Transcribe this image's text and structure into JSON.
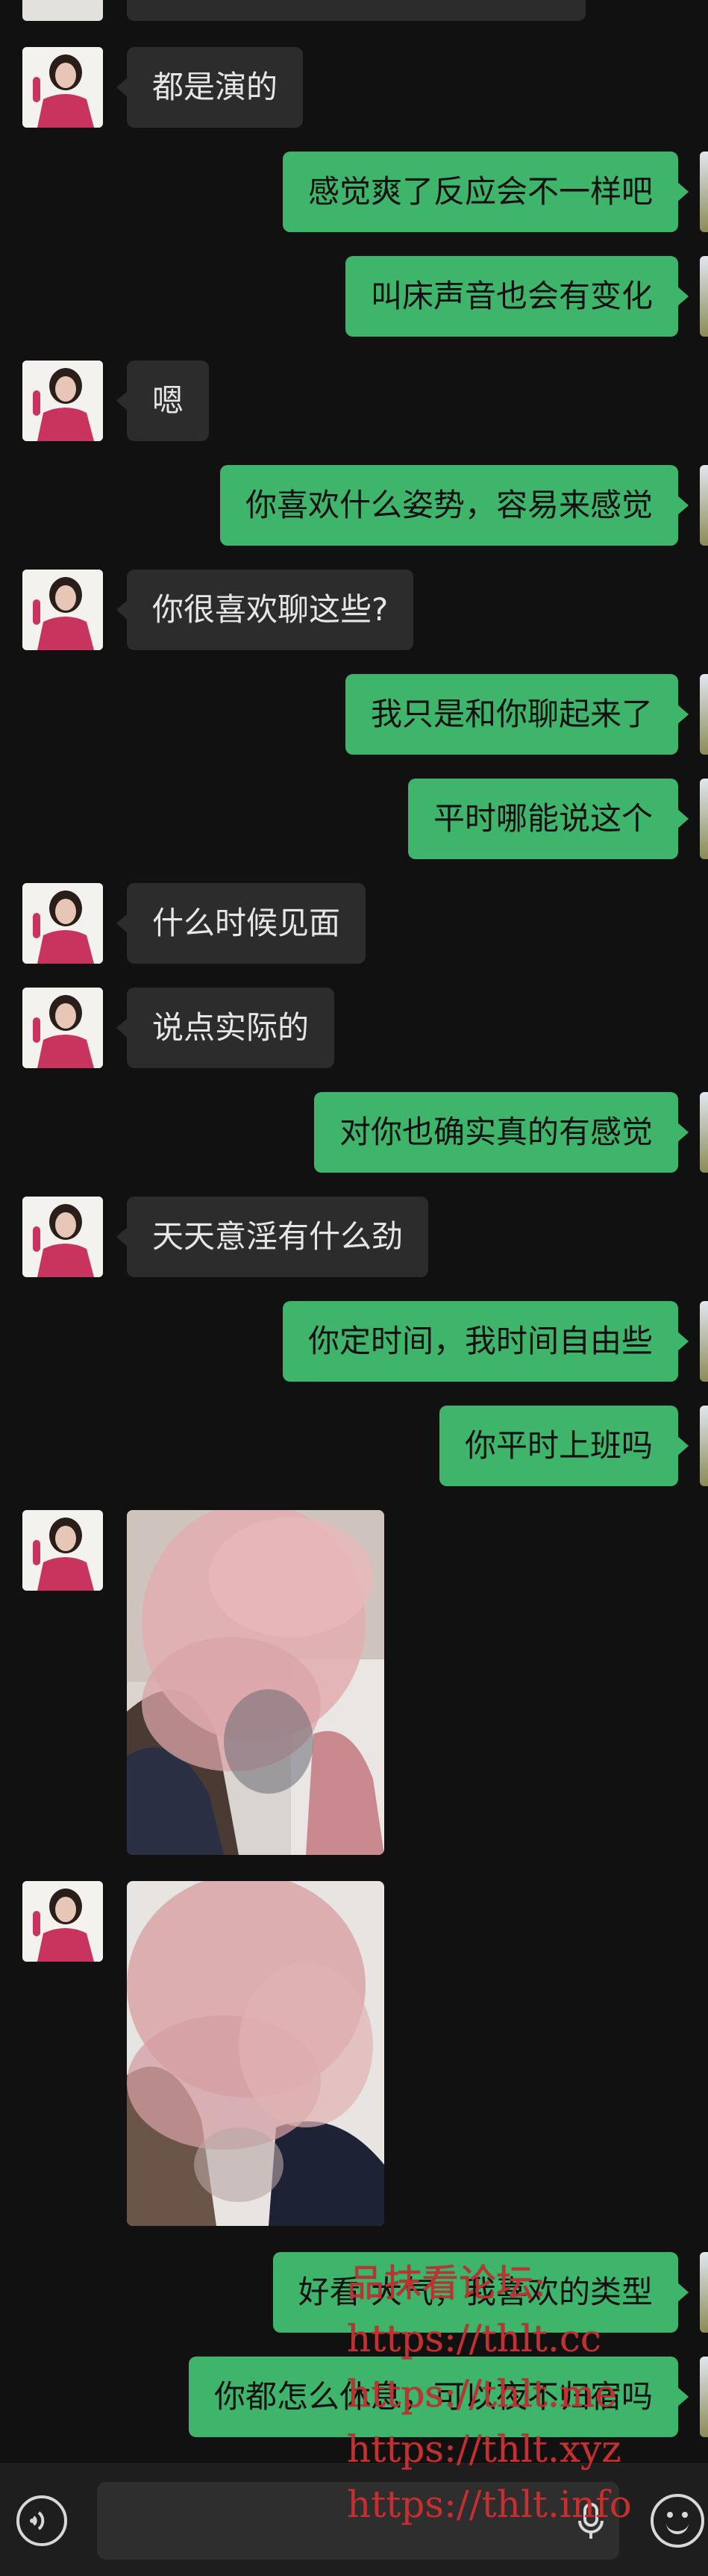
{
  "messages": [
    {
      "side": "in",
      "text": "都是演的"
    },
    {
      "side": "out",
      "text": "感觉爽了反应会不一样吧"
    },
    {
      "side": "out",
      "text": "叫床声音也会有变化"
    },
    {
      "side": "in",
      "text": "嗯"
    },
    {
      "side": "out",
      "text": "你喜欢什么姿势，容易来感觉"
    },
    {
      "side": "in",
      "text": "你很喜欢聊这些?"
    },
    {
      "side": "out",
      "text": "我只是和你聊起来了"
    },
    {
      "side": "out",
      "text": "平时哪能说这个"
    },
    {
      "side": "in",
      "text": "什么时候见面"
    },
    {
      "side": "in",
      "text": "说点实际的"
    },
    {
      "side": "out",
      "text": "对你也确实真的有感觉"
    },
    {
      "side": "in",
      "text": "天天意淫有什么劲"
    },
    {
      "side": "out",
      "text": "你定时间，我时间自由些"
    },
    {
      "side": "out",
      "text": "你平时上班吗"
    },
    {
      "side": "out",
      "text": "好看 大气，我喜欢的类型"
    },
    {
      "side": "out",
      "text": "你都怎么休息，可以夜不归宿吗"
    }
  ],
  "photos": [
    {
      "name": "photo-message-1",
      "description_visible": false
    },
    {
      "name": "photo-message-2",
      "description_visible": false
    }
  ],
  "input": {
    "placeholder": "",
    "value": ""
  },
  "watermark": {
    "lines": [
      "品抹看论坛:",
      "https://thlt.cc",
      "https://thlt.me",
      "https://thlt.xyz",
      "https://thlt.info"
    ]
  },
  "colors": {
    "background": "#111111",
    "incoming_bubble": "#2c2c2c",
    "outgoing_bubble": "#3fb46b",
    "watermark": "#c23131"
  },
  "icons": {
    "voice": "voice-toggle-icon",
    "mic": "microphone-icon",
    "emoji": "emoji-icon"
  }
}
